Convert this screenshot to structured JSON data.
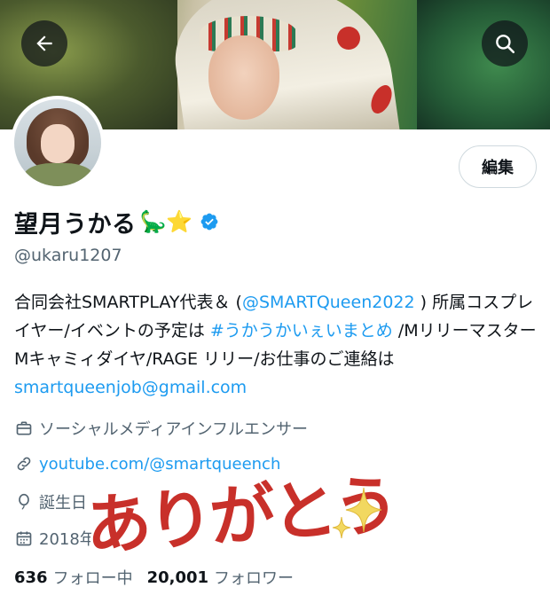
{
  "header": {
    "back_icon": "arrow-left-icon",
    "search_icon": "search-icon"
  },
  "profile": {
    "display_name": "望月うかる",
    "name_emojis": "🦕⭐",
    "handle": "@ukaru1207",
    "edit_label": "編集",
    "verified_color": "#1d9bf0"
  },
  "bio": {
    "part1": "合同会社SMARTPLAY代表＆ (",
    "mention": "@SMARTQueen2022",
    "part2": " ) 所属コスプレイヤー/イベントの予定は ",
    "hashtag": "#うかうかいぇいまとめ",
    "part3": " /MリリーマスターMキャミィダイヤ/RAGE リリー/お仕事のご連絡は ",
    "email": "smartqueenjob@gmail.com"
  },
  "meta": {
    "job": "ソーシャルメディアインフルエンサー",
    "link": "youtube.com/@smartqueench",
    "birth": "誕生日",
    "joined": "2018年"
  },
  "stats": {
    "following_count": "636",
    "following_label": "フォロー中",
    "followers_count": "20,001",
    "followers_label": "フォロワー"
  },
  "sticker": {
    "text": "ありがとう"
  },
  "colors": {
    "accent": "#1d9bf0",
    "secondary_text": "#536471",
    "sticker_red": "#c8302a",
    "sparkle_yellow": "#f2d860"
  }
}
